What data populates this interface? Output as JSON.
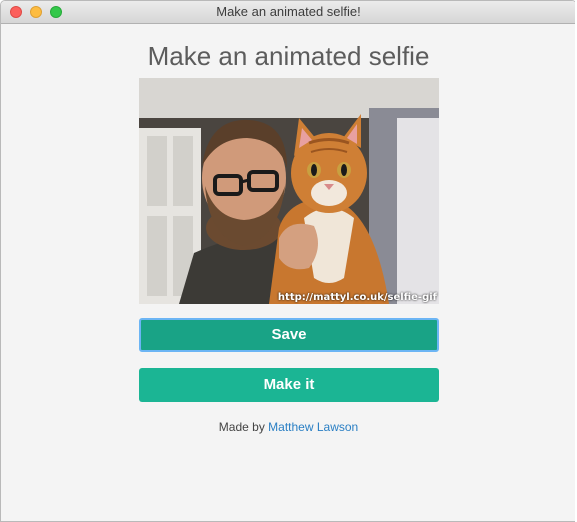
{
  "window": {
    "title": "Make an animated selfie!"
  },
  "page": {
    "heading": "Make an animated selfie"
  },
  "preview": {
    "watermark": "http://mattyl.co.uk/selfie-gif"
  },
  "buttons": {
    "save_label": "Save",
    "make_label": "Make it"
  },
  "footer": {
    "prefix": "Made by ",
    "author": "Matthew Lawson"
  },
  "colors": {
    "accent": "#1bb594",
    "save_active": "#19a386",
    "focus_ring": "#6cb5f4",
    "link": "#2a7fc4"
  }
}
